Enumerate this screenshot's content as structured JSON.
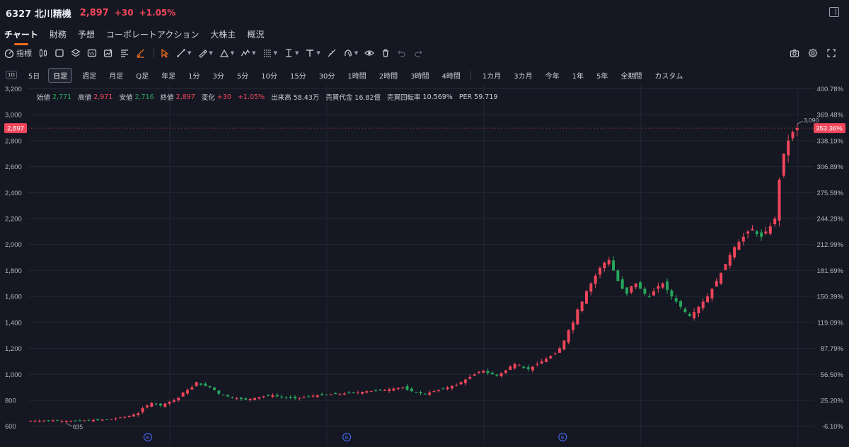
{
  "header": {
    "ticker": "6327 北川精機",
    "last": "2,897",
    "change": "+30",
    "change_pct": "+1.05%"
  },
  "tabs": [
    "チャート",
    "財務",
    "予想",
    "コーポレートアクション",
    "大株主",
    "概況"
  ],
  "toolbar": {
    "indicator_label": "指標",
    "tools": [
      "candle-type-icon",
      "rectangle-icon",
      "layers-icon",
      "compare-icon",
      "chart-add-icon",
      "text-lines-icon",
      "paint-brush-icon",
      "cursor-icon",
      "trend-line-icon",
      "brush-icon",
      "triangle-icon",
      "pattern-icon",
      "fib-icon",
      "measure-icon",
      "text-tool-icon",
      "ruler-icon",
      "magnet-icon",
      "eye-icon",
      "trash-icon",
      "undo-icon",
      "redo-icon"
    ],
    "right_tools": [
      "camera-icon",
      "settings-icon",
      "fullscreen-icon"
    ],
    "accent": "#f26b1d"
  },
  "periods": [
    "1D",
    "5日",
    "日足",
    "週足",
    "月足",
    "Q足",
    "年足",
    "1分",
    "3分",
    "5分",
    "10分",
    "15分",
    "30分",
    "1時間",
    "2時間",
    "3時間",
    "4時間",
    "1カ月",
    "3カ月",
    "今年",
    "1年",
    "5年",
    "全期間",
    "カスタム"
  ],
  "active_period": "日足",
  "info": {
    "open_label": "始値",
    "open": "2,771",
    "high_label": "高値",
    "high": "2,971",
    "low_label": "安値",
    "low": "2,716",
    "close_label": "終値",
    "close": "2,897",
    "change_label": "変化",
    "change": "+30",
    "change_pct": "+1.05%",
    "volume_label": "出来高",
    "volume": "58.43万",
    "value_label": "売買代金",
    "value": "16.82億",
    "turnover_label": "売買回転率",
    "turnover": "10.569%",
    "per_label": "PER",
    "per": "59.719"
  },
  "colors": {
    "up": "#f0455a",
    "down": "#26a65b",
    "background": "#151823",
    "grid": "#232733"
  },
  "chart_data": {
    "type": "candlestick",
    "y_ticks": [
      "3,200",
      "3,000",
      "2,800",
      "2,600",
      "2,400",
      "2,200",
      "2,000",
      "1,800",
      "1,600",
      "1,400",
      "1,200",
      "1,000",
      "800",
      "600"
    ],
    "pct_ticks": [
      "400.78%",
      "369.48%",
      "338.19%",
      "306.89%",
      "275.59%",
      "244.29%",
      "212.99%",
      "181.69%",
      "150.39%",
      "119.09%",
      "87.79%",
      "56.50%",
      "25.20%",
      "-6.10%"
    ],
    "ylim": [
      560,
      3230
    ],
    "current_price_label": "2,897",
    "current_pct_label": "353.36%",
    "max_label": "3,090",
    "min_label": "635",
    "event_marker": "E",
    "event_positions": [
      0.155,
      0.413,
      0.693
    ],
    "closes": [
      641,
      643,
      642,
      644,
      642,
      645,
      643,
      640,
      642,
      641,
      639,
      641,
      645,
      644,
      648,
      646,
      650,
      652,
      655,
      660,
      668,
      672,
      680,
      690,
      700,
      740,
      760,
      780,
      770,
      760,
      775,
      790,
      800,
      820,
      860,
      880,
      900,
      940,
      920,
      910,
      900,
      880,
      850,
      840,
      830,
      820,
      815,
      810,
      805,
      812,
      818,
      825,
      830,
      835,
      840,
      830,
      825,
      820,
      818,
      815,
      820,
      825,
      830,
      835,
      838,
      840,
      842,
      845,
      848,
      850,
      852,
      855,
      858,
      860,
      865,
      870,
      872,
      875,
      878,
      880,
      885,
      890,
      895,
      900,
      880,
      870,
      860,
      855,
      850,
      860,
      870,
      880,
      890,
      900,
      910,
      920,
      940,
      960,
      980,
      1000,
      1020,
      1030,
      1010,
      1000,
      990,
      1010,
      1030,
      1060,
      1080,
      1070,
      1050,
      1040,
      1060,
      1080,
      1100,
      1120,
      1140,
      1160,
      1200,
      1260,
      1340,
      1400,
      1500,
      1560,
      1640,
      1700,
      1760,
      1820,
      1860,
      1880,
      1800,
      1720,
      1660,
      1620,
      1680,
      1700,
      1660,
      1620,
      1600,
      1640,
      1680,
      1700,
      1650,
      1600,
      1560,
      1520,
      1480,
      1450,
      1480,
      1520,
      1560,
      1600,
      1660,
      1720,
      1780,
      1850,
      1920,
      1980,
      2020,
      2060,
      2100,
      2120,
      2080,
      2060,
      2100,
      2140,
      2200,
      2500,
      2700,
      2800,
      2867,
      2897
    ]
  }
}
